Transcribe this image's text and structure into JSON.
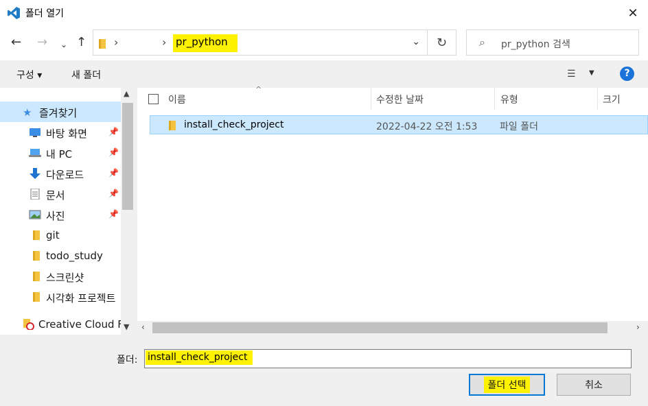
{
  "window": {
    "title": "폴더 열기",
    "close_label": "✕"
  },
  "address": {
    "current": "pr_python",
    "search_placeholder": "pr_python 검색"
  },
  "toolbar": {
    "organize_label": "구성 ▾",
    "new_folder_label": "새 폴더"
  },
  "nav": {
    "items": [
      {
        "label": "즐겨찾기",
        "icon": "star-icon"
      },
      {
        "label": "바탕 화면",
        "icon": "desktop-icon",
        "pinned": true
      },
      {
        "label": "내 PC",
        "icon": "pc-icon",
        "pinned": true
      },
      {
        "label": "다운로드",
        "icon": "download-icon",
        "pinned": true
      },
      {
        "label": "문서",
        "icon": "document-icon",
        "pinned": true
      },
      {
        "label": "사진",
        "icon": "picture-icon",
        "pinned": true
      },
      {
        "label": "git",
        "icon": "folder-icon"
      },
      {
        "label": "todo_study",
        "icon": "folder-icon"
      },
      {
        "label": "스크린샷",
        "icon": "folder-icon"
      },
      {
        "label": "시각화 프로젝트",
        "icon": "folder-icon"
      },
      {
        "label": "Creative Cloud Fil",
        "icon": "creative-cloud-icon"
      }
    ]
  },
  "columns": {
    "name": "이름",
    "modified": "수정한 날짜",
    "type": "유형",
    "size": "크기"
  },
  "files": [
    {
      "name": "install_check_project",
      "modified": "2022-04-22 오전 1:53",
      "type": "파일 폴더"
    }
  ],
  "footer": {
    "folder_label": "폴더:",
    "folder_value": "install_check_project",
    "select_button": "폴더 선택",
    "cancel_button": "취소"
  }
}
